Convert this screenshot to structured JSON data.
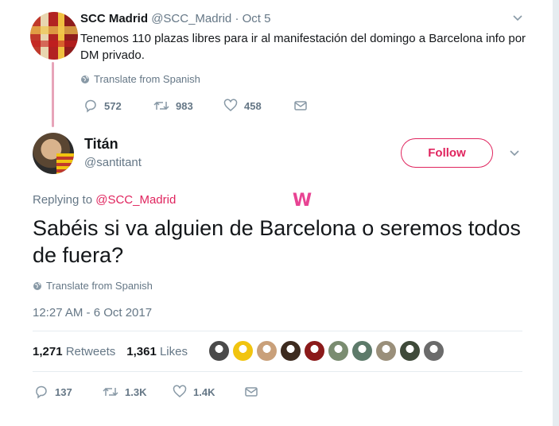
{
  "parent_tweet": {
    "author_name": "SCC Madrid",
    "author_handle": "@SCC_Madrid",
    "separator": "·",
    "date": "Oct 5",
    "text": "Tenemos 110 plazas libres para ir al manifestación del domingo a Barcelona info por DM privado.",
    "translate_label": "Translate from Spanish",
    "actions": {
      "replies": "572",
      "retweets": "983",
      "likes": "458"
    }
  },
  "main_tweet": {
    "author_name": "Titán",
    "author_handle": "@santitant",
    "follow_label": "Follow",
    "replying_prefix": "Replying to",
    "replying_mention": "@SCC_Madrid",
    "badge": "W",
    "text": "Sabéis si va alguien de Barcelona o seremos todos de fuera?",
    "translate_label": "Translate from Spanish",
    "timestamp": "12:27 AM - 6 Oct 2017",
    "stats": {
      "retweets_count": "1,271",
      "retweets_label": "Retweets",
      "likes_count": "1,361",
      "likes_label": "Likes"
    },
    "actions": {
      "replies": "137",
      "retweets": "1.3K",
      "likes": "1.4K"
    }
  },
  "colors": {
    "accent": "#e0245e",
    "muted_text": "#657786",
    "thread_line": "#e7a4b9"
  },
  "liker_avatar_colors": [
    "#4a4a4a",
    "#f1c40f",
    "#c9a07a",
    "#3d2b1f",
    "#8b1a1a",
    "#7a8c70",
    "#5d7a6a",
    "#9a8f7a",
    "#3f4a3a",
    "#6b6b6b"
  ]
}
